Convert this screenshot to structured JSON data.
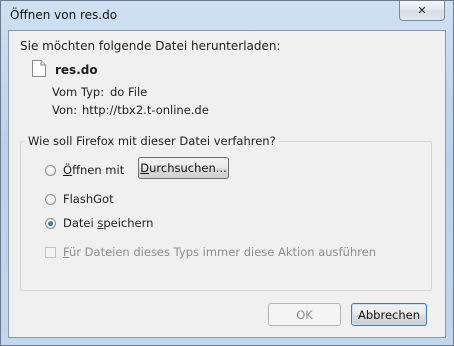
{
  "window": {
    "title": "Öffnen von res.do",
    "close_glyph": "✕"
  },
  "dialog": {
    "prompt": "Sie möchten folgende Datei herunterladen:",
    "file": {
      "name": "res.do",
      "type_label": "Vom Typ:",
      "type_value": "do File",
      "from_label": "Von:",
      "from_value": "http://tbx2.t-online.de"
    },
    "group": {
      "legend": "Wie soll Firefox mit dieser Datei verfahren?",
      "options": [
        {
          "label_first": "Ö",
          "label_rest": "ffnen mit",
          "selected": false
        },
        {
          "label_first": "",
          "label_rest": "FlashGot",
          "selected": false
        },
        {
          "label_first": "Datei ",
          "label_underline": "s",
          "label_rest": "peichern",
          "selected": true
        }
      ],
      "browse_button": {
        "underline": "D",
        "rest": "urchsuchen..."
      },
      "remember": {
        "underline": "F",
        "rest": "ür Dateien dieses Typs immer diese Aktion ausführen",
        "checked": false,
        "enabled": false
      }
    },
    "buttons": {
      "ok": "OK",
      "cancel": "Abbrechen"
    }
  },
  "colors": {
    "titlebar": "#c2d7ee",
    "client": "#f0f0f0",
    "radio_dot": "#1f3f7a"
  }
}
